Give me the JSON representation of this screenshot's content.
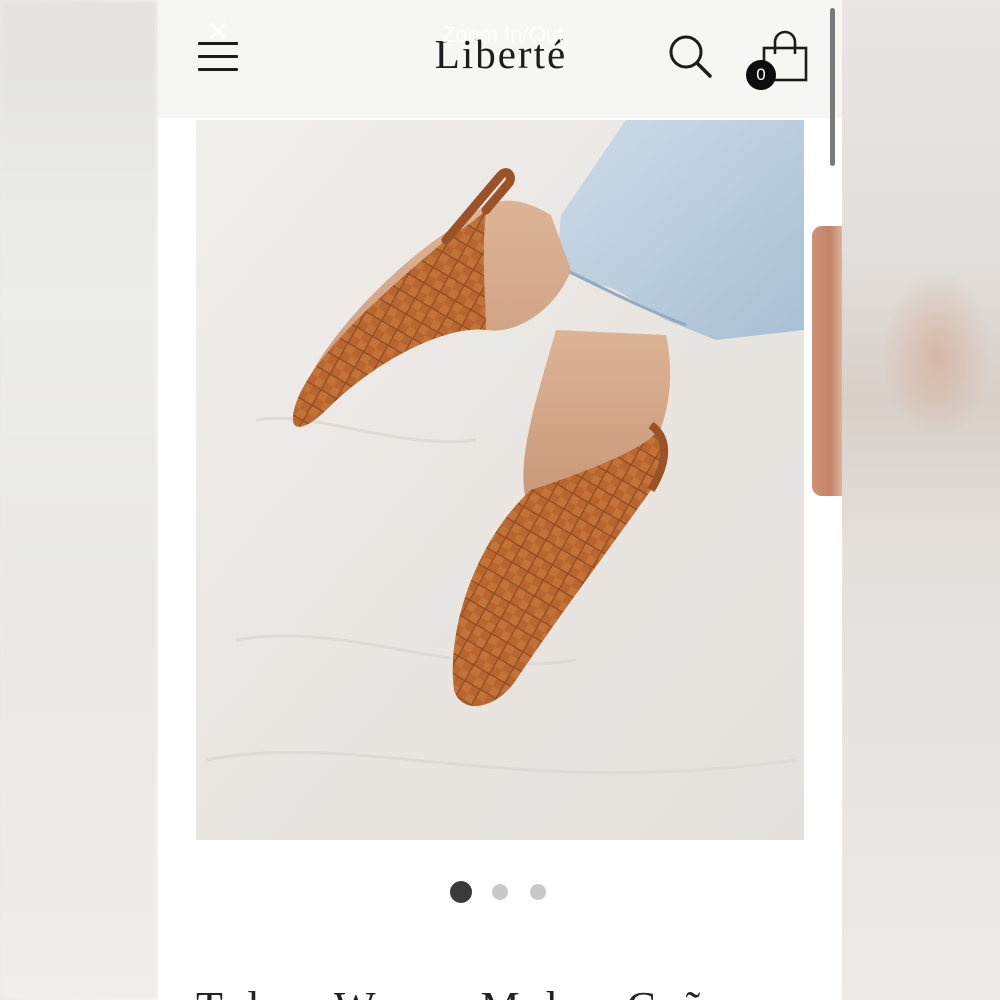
{
  "header": {
    "logo": "Liberté",
    "zoom_label": "Zoom In/Out",
    "close_glyph": "✕",
    "cart_count": "0",
    "icons": [
      "hamburger-menu-icon",
      "search-icon",
      "shopping-bag-icon",
      "close-icon"
    ]
  },
  "gallery": {
    "image_alt": "Woven leather mules worn with light wash jeans",
    "slide_count": 3,
    "active_slide": 1
  },
  "product": {
    "title_partial": "Tulum Woven Mules, Coñac"
  },
  "colors": {
    "header_bg": "#f6f6f3",
    "accent_dark": "#1d1d1d",
    "leather": "#b5622f",
    "denim": "#b8cde0"
  }
}
